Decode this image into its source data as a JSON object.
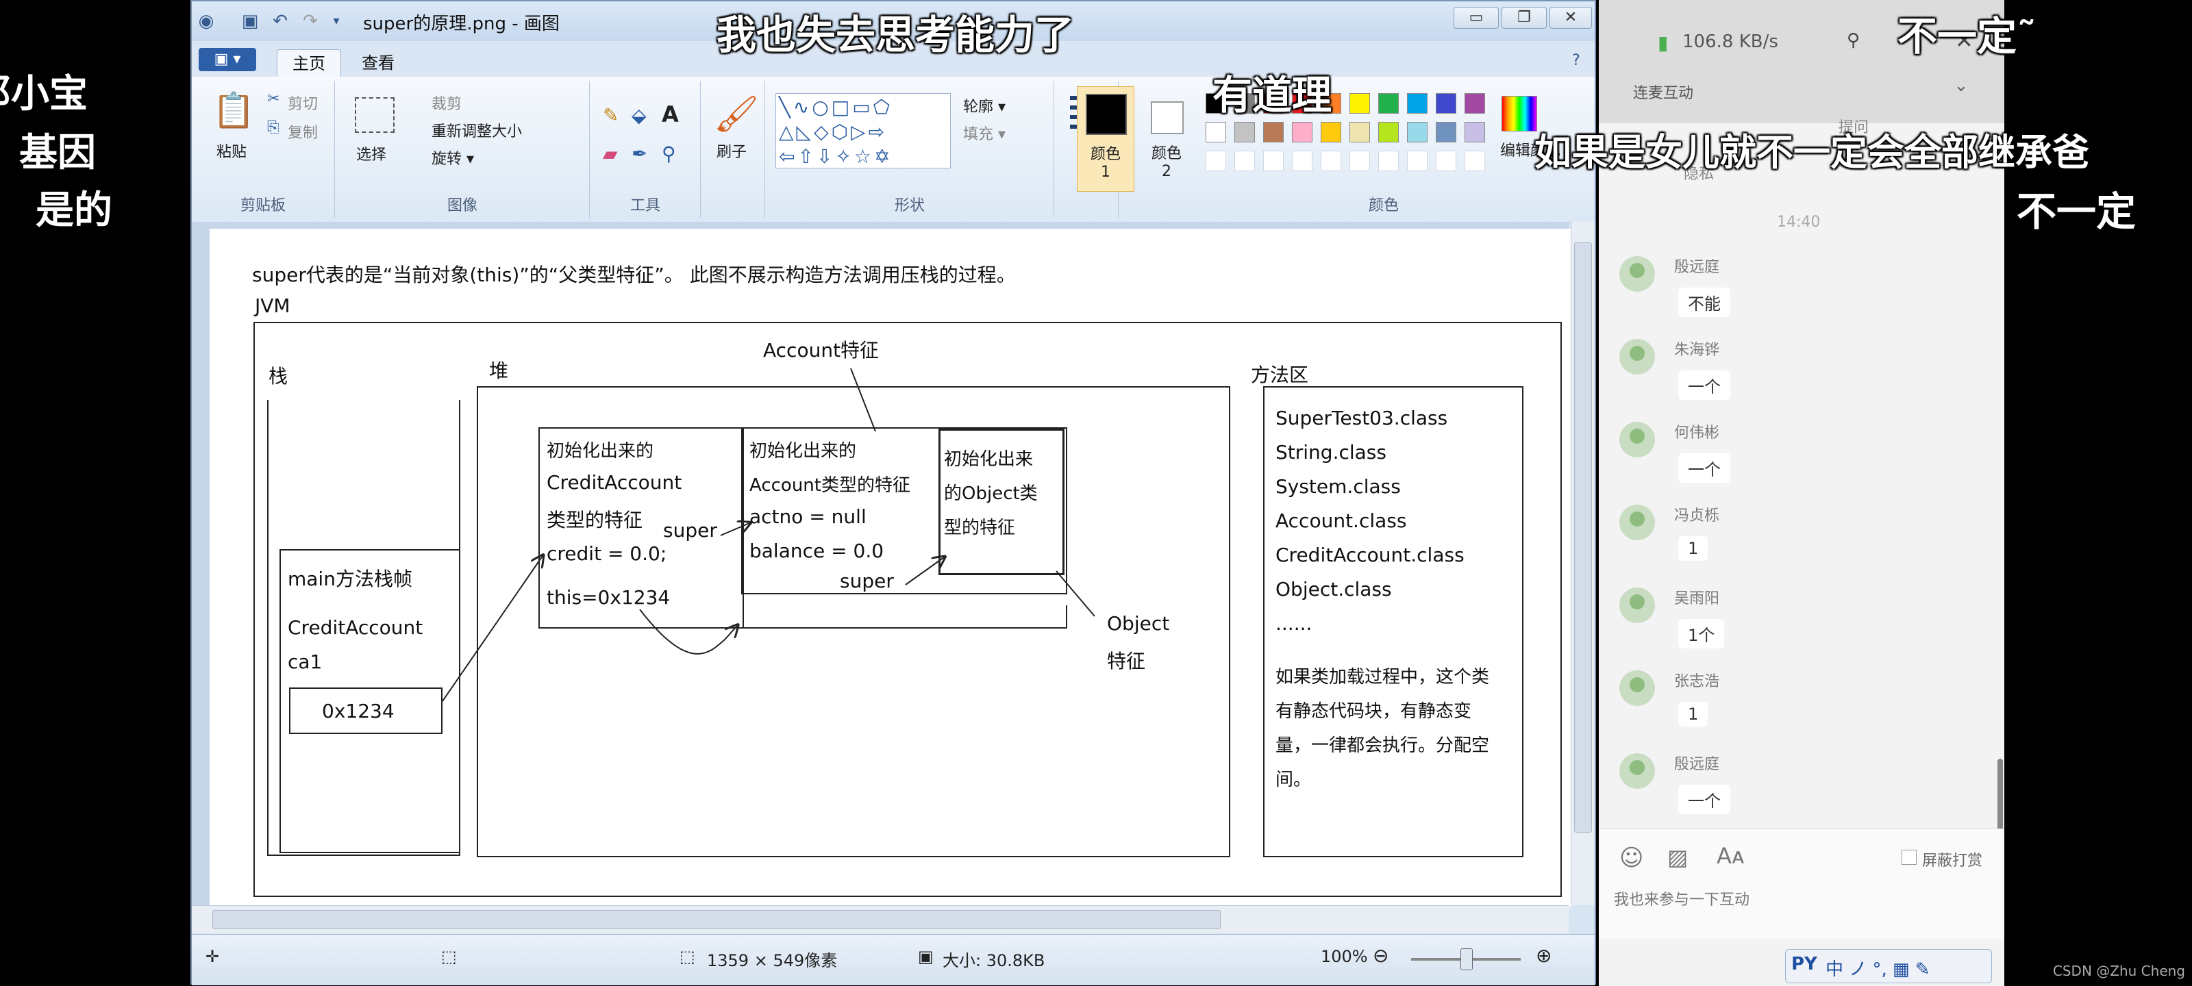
{
  "danmaku": {
    "top_center": "我也失去思考能力了",
    "top_right": "不一定˜",
    "middle": "有道理",
    "right": "如果是女儿就不一定会全部继承爸",
    "right_bottom": "不一定"
  },
  "left_strip": [
    "邓小宝",
    "基因",
    "是的"
  ],
  "paint": {
    "title": "super的原理.png - 画图",
    "menu": {
      "file": "▣ ▾",
      "tabs": [
        "主页",
        "查看"
      ]
    },
    "ribbon": {
      "clipboard": {
        "label": "剪贴板",
        "paste": "粘贴",
        "cut": "剪切",
        "copy": "复制"
      },
      "image": {
        "label": "图像",
        "select": "选择",
        "crop": "裁剪",
        "resize": "重新调整大小",
        "rotate": "旋转 ▾"
      },
      "tools": {
        "label": "工具"
      },
      "brushes": {
        "label": "刷子"
      },
      "shapes": {
        "label": "形状",
        "outline": "轮廓 ▾",
        "fill": "填充 ▾"
      },
      "size": {
        "label": "粗细"
      },
      "color1": {
        "label": "颜色 1"
      },
      "color2": {
        "label": "颜色 2"
      },
      "colors": {
        "label": "颜色",
        "edit": "编辑颜色"
      }
    },
    "palette": [
      "#000000",
      "#7f7f7f",
      "#880015",
      "#ed1c24",
      "#ff7f27",
      "#fff200",
      "#22b14c",
      "#00a2e8",
      "#3f48cc",
      "#a349a4",
      "#ffffff",
      "#c3c3c3",
      "#b97a57",
      "#ffaec9",
      "#ffc90e",
      "#efe4b0",
      "#b5e61d",
      "#99d9ea",
      "#7092be",
      "#c8bfe7"
    ],
    "canvas": {
      "header": "super代表的是“当前对象(this)”的“父类型特征”。     此图不展示构造方法调用压栈的过程。",
      "jvm": "JVM",
      "stack": "栈",
      "heap": "堆",
      "method_area": "方法区",
      "account_feature": "Account特征",
      "object_feature": [
        "Object",
        "特征"
      ],
      "frame_title": "main方法栈帧",
      "frame_var": [
        "CreditAccount",
        "ca1"
      ],
      "frame_value": "0x1234",
      "credit_box": [
        "初始化出来的",
        "CreditAccount",
        "类型的特征",
        "credit = 0.0;",
        "this=0x1234"
      ],
      "account_box": [
        "初始化出来的",
        "Account类型的特征",
        "actno = null",
        "balance = 0.0"
      ],
      "object_box": [
        "初始化出来",
        "的Object类",
        "型的特征"
      ],
      "super_label": "super",
      "classes": [
        "SuperTest03.class",
        "String.class",
        "System.class",
        "Account.class",
        "CreditAccount.class",
        "Object.class",
        "......"
      ],
      "class_note": [
        "如果类加载过程中，这个类",
        "有静态代码块，有静态变",
        "量，一律都会执行。分配空",
        "间。"
      ]
    },
    "status": {
      "dims": "1359 × 549像素",
      "size": "大小: 30.8KB",
      "zoom": "100%"
    }
  },
  "chat": {
    "network": "106.8 KB/s",
    "tab": "连麦互动",
    "tab2": "提问",
    "time": "14:40",
    "partial": "隐私",
    "messages": [
      {
        "name": "殷远庭",
        "text": "不能"
      },
      {
        "name": "朱海铧",
        "text": "一个"
      },
      {
        "name": "何伟彬",
        "text": "一个"
      },
      {
        "name": "冯贞栎",
        "text": "1"
      },
      {
        "name": "吴雨阳",
        "text": "1个"
      },
      {
        "name": "张志浩",
        "text": "1"
      },
      {
        "name": "殷远庭",
        "text": "一个"
      }
    ],
    "shield": "屏蔽打赏",
    "input_placeholder": "我也来参与一下互动",
    "ime": "中 ノ °, ▦ ✎"
  },
  "watermark": "CSDN @Zhu Cheng"
}
